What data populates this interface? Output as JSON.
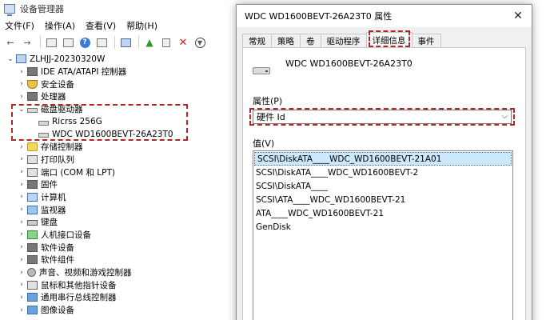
{
  "device_manager": {
    "title": "设备管理器",
    "menu": [
      "文件(F)",
      "操作(A)",
      "查看(V)",
      "帮助(H)"
    ],
    "tree": [
      {
        "label": "ZLHJJ-20230320W",
        "level": 0,
        "expand": "v",
        "icon": "computer-icon"
      },
      {
        "label": "IDE ATA/ATAPI 控制器",
        "level": 1,
        "expand": ">",
        "icon": "chip-icon"
      },
      {
        "label": "安全设备",
        "level": 1,
        "expand": ">",
        "icon": "shield-icon"
      },
      {
        "label": "处理器",
        "level": 1,
        "expand": ">",
        "icon": "chip-icon"
      },
      {
        "label": "磁盘驱动器",
        "level": 1,
        "expand": "v",
        "icon": "disk-icon"
      },
      {
        "label": "Ricrss 256G",
        "level": 2,
        "expand": "",
        "icon": "disk-icon"
      },
      {
        "label": "WDC WD1600BEVT-26A23T0",
        "level": 2,
        "expand": "",
        "icon": "disk-icon"
      },
      {
        "label": "存储控制器",
        "level": 1,
        "expand": ">",
        "icon": "gear-icon"
      },
      {
        "label": "打印队列",
        "level": 1,
        "expand": ">",
        "icon": "printer-icon"
      },
      {
        "label": "端口 (COM 和 LPT)",
        "level": 1,
        "expand": ">",
        "icon": "port-icon"
      },
      {
        "label": "固件",
        "level": 1,
        "expand": ">",
        "icon": "chip-icon"
      },
      {
        "label": "计算机",
        "level": 1,
        "expand": ">",
        "icon": "computer-icon"
      },
      {
        "label": "监视器",
        "level": 1,
        "expand": ">",
        "icon": "monitor-icon"
      },
      {
        "label": "键盘",
        "level": 1,
        "expand": ">",
        "icon": "keyboard-icon"
      },
      {
        "label": "人机接口设备",
        "level": 1,
        "expand": ">",
        "icon": "hid-icon"
      },
      {
        "label": "软件设备",
        "level": 1,
        "expand": ">",
        "icon": "chip-icon"
      },
      {
        "label": "软件组件",
        "level": 1,
        "expand": ">",
        "icon": "chip-icon"
      },
      {
        "label": "声音、视频和游戏控制器",
        "level": 1,
        "expand": ">",
        "icon": "sound-icon"
      },
      {
        "label": "鼠标和其他指针设备",
        "level": 1,
        "expand": ">",
        "icon": "mouse-icon"
      },
      {
        "label": "通用串行总线控制器",
        "level": 1,
        "expand": ">",
        "icon": "usb-icon"
      },
      {
        "label": "图像设备",
        "level": 1,
        "expand": ">",
        "icon": "camera-icon"
      }
    ]
  },
  "dialog": {
    "title": "WDC WD1600BEVT-26A23T0 属性",
    "tabs": [
      "常规",
      "策略",
      "卷",
      "驱动程序",
      "详细信息",
      "事件"
    ],
    "active_tab": "详细信息",
    "device_name": "WDC WD1600BEVT-26A23T0",
    "property_label": "属性(P)",
    "property_value": "硬件 Id",
    "value_label": "值(V)",
    "values": [
      "SCSI\\DiskATA____WDC_WD1600BEVT-21A01",
      "SCSI\\DiskATA____WDC_WD1600BEVT-2",
      "SCSI\\DiskATA____",
      "SCSI\\ATA____WDC_WD1600BEVT-21",
      "ATA____WDC_WD1600BEVT-21",
      "GenDisk"
    ]
  },
  "colors": {
    "highlight_dash": "#b0262a",
    "selection": "#cce8ff"
  }
}
